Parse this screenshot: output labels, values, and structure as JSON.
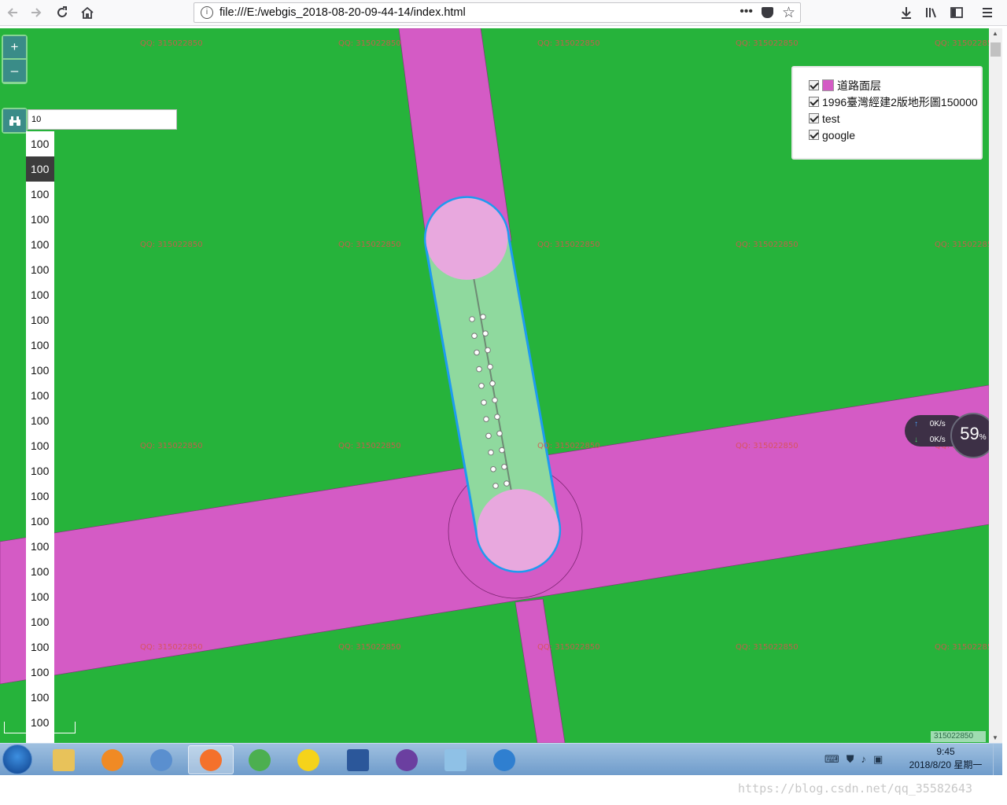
{
  "browser": {
    "url": "file:///E:/webgis_2018-08-20-09-44-14/index.html",
    "nav_icons": [
      "back-icon",
      "forward-icon",
      "reload-icon",
      "home-icon"
    ],
    "right_icons": [
      "page-actions-icon",
      "pocket-icon",
      "bookmark-star-icon",
      "downloads-icon",
      "library-icon",
      "sidebar-icon",
      "menu-icon"
    ]
  },
  "map": {
    "background_color": "#26b33b",
    "road_color": "#d45bc5",
    "buffer_color": "#e8a8de",
    "buffer_outline_color": "#1e9bf0",
    "watermark_text": "QQ: 315022850",
    "zoom": {
      "in_label": "+",
      "out_label": "–"
    },
    "search": {
      "value": "10",
      "icon": "binoculars-icon"
    },
    "dropdown": {
      "options": [
        "100",
        "100",
        "100",
        "100",
        "100",
        "100",
        "100",
        "100",
        "100",
        "100",
        "100",
        "100",
        "100",
        "100",
        "100",
        "100",
        "100",
        "100",
        "100",
        "100",
        "100",
        "100",
        "100",
        "100"
      ],
      "selected_index": 1
    },
    "layers": [
      {
        "label": "道路面层",
        "checked": true,
        "swatch_color": "#d45bc5"
      },
      {
        "label": "1996臺灣經建2版地形圖150000",
        "checked": true
      },
      {
        "label": "test",
        "checked": true
      },
      {
        "label": "google",
        "checked": true
      }
    ],
    "qq_badge": "315022850"
  },
  "net_monitor": {
    "up": "0K/s",
    "down": "0K/s",
    "percent": "59",
    "percent_unit": "%"
  },
  "taskbar": {
    "apps": [
      "explorer-icon",
      "media-player-icon",
      "vmware-icon",
      "firefox-icon",
      "chrome-icon",
      "qq-music-icon",
      "word-icon",
      "visual-studio-icon",
      "notepad-icon",
      "globe-icon"
    ],
    "active_app": "firefox-icon",
    "time": "9:45",
    "date": "2018/8/20 星期一"
  },
  "footer_watermark": "https://blog.csdn.net/qq_35582643"
}
